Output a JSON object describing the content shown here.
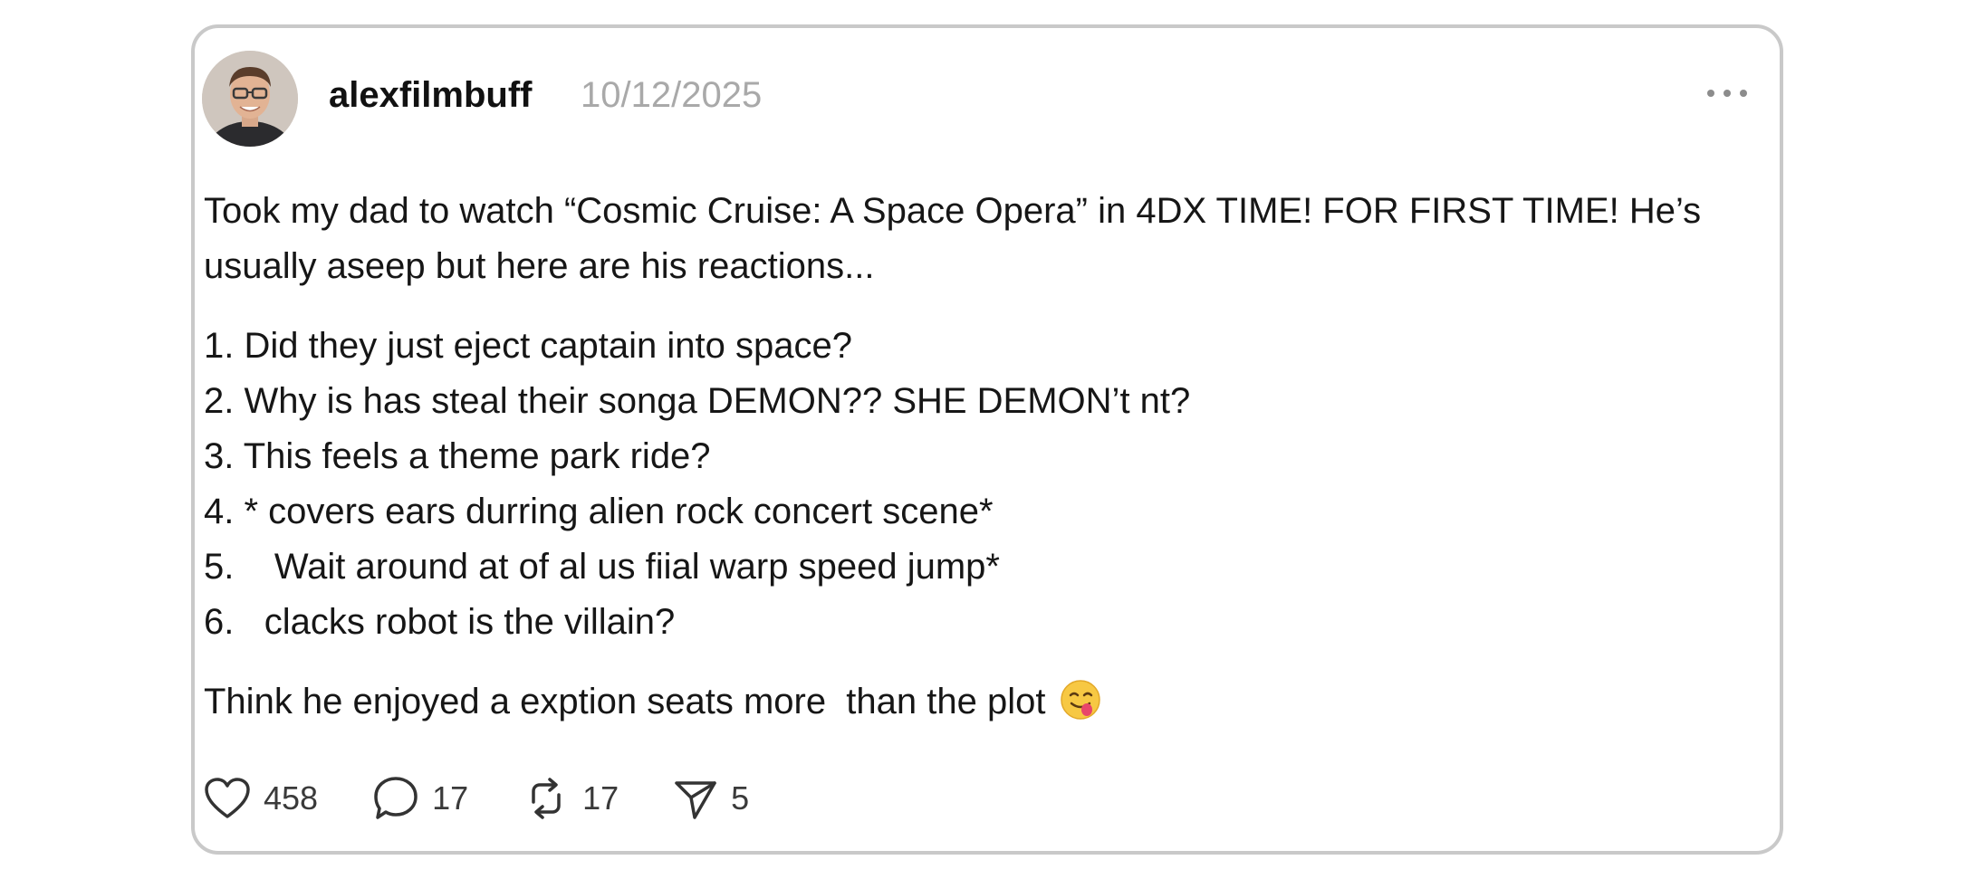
{
  "post": {
    "username": "alexfilmbuff",
    "date": "10/12/2025",
    "intro": "Took my dad to watch “Cosmic Cruise: A Space Opera” in 4DX TIME! FOR FIRST TIME! He’s usually aseep but here are his reactions...",
    "reactions": [
      "1. Did they just eject captain into space?",
      "2. Why is has steal their songa DEMON?? SHE DEMON’t nt?",
      "3. This feels a theme park ride?",
      "4. * covers ears durring alien rock concert scene*",
      "5.    Wait around at of al us fiial warp speed jump*",
      "6.   clacks robot is the villain?"
    ],
    "outro": "Think he enjoyed a exption seats more  than the plot",
    "outro_emoji_icon": "face-savoring-food-emoji"
  },
  "actions": {
    "likes": "458",
    "comments": "17",
    "reposts": "17",
    "shares": "5"
  },
  "icons": {
    "like": "heart-icon",
    "comment": "comment-bubble-icon",
    "repost": "repost-icon",
    "share": "send-icon",
    "more": "more-horizontal-icon"
  }
}
